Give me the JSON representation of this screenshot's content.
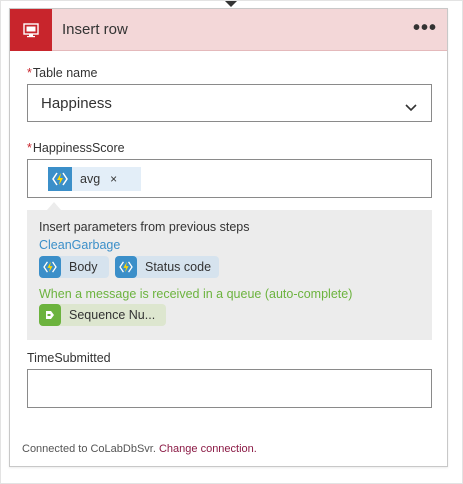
{
  "action": {
    "title": "Insert row",
    "menu_label": "•••",
    "header_color": "#c8252c"
  },
  "fields": {
    "table_name": {
      "required_mark": "*",
      "label": "Table name",
      "value": "Happiness"
    },
    "happiness_score": {
      "required_mark": "*",
      "label": "HappinessScore",
      "token_label": "avg",
      "token_remove": "×"
    },
    "time_submitted": {
      "label": "TimeSubmitted",
      "value": ""
    }
  },
  "dynamic_content": {
    "heading": "Insert parameters from previous steps",
    "groups": [
      {
        "name": "CleanGarbage",
        "color": "#3b8fc9",
        "chips": [
          "Body",
          "Status code"
        ]
      },
      {
        "name": "When a message is received in a queue (auto-complete)",
        "color": "#6cb33e",
        "chips": [
          "Sequence Nu..."
        ]
      }
    ]
  },
  "footer": {
    "connected_text": "Connected to CoLabDbSvr.",
    "change_link": "Change connection."
  },
  "icons": {
    "header": "sql-database-icon",
    "token": "azure-function-icon",
    "chip_blue": "azure-function-icon",
    "chip_green": "service-bus-icon",
    "dropdown": "chevron-down-icon"
  }
}
